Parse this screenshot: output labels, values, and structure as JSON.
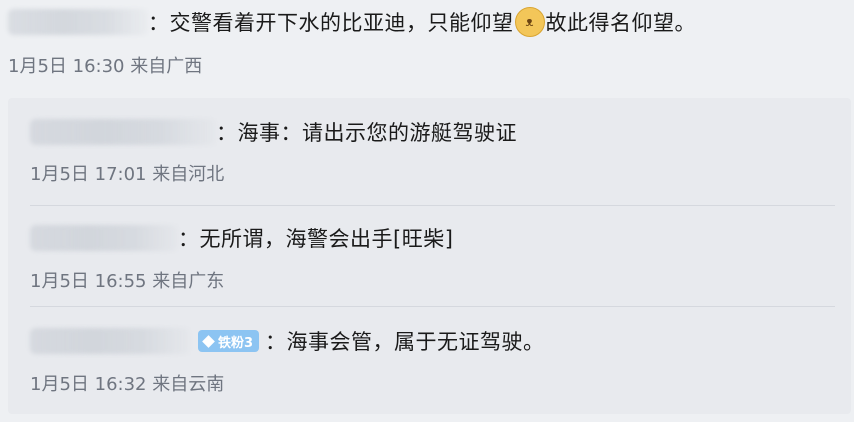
{
  "main_comment": {
    "text": "：交警看着开下水的比亚迪，只能仰望",
    "emoji_name": "cat-face-emoji",
    "text_after": "故此得名仰望。",
    "timestamp": "1月5日 16:30 来自广西"
  },
  "replies": [
    {
      "text": "：海事：请出示您的游艇驾驶证",
      "timestamp": "1月5日 17:01 来自河北"
    },
    {
      "text": "：无所谓，海警会出手[旺柴]",
      "timestamp": "1月5日 16:55 来自广东"
    },
    {
      "badge": "铁粉3",
      "text": "：海事会管，属于无证驾驶。",
      "timestamp": "1月5日 16:32 来自云南"
    }
  ]
}
